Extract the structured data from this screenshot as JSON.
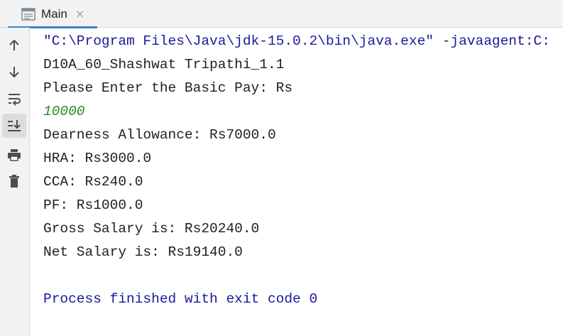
{
  "tab": {
    "label": "Main",
    "close_glyph": "×",
    "icon": "console-window-icon"
  },
  "toolbar": {
    "buttons": [
      {
        "name": "up-arrow-icon",
        "active": false
      },
      {
        "name": "down-arrow-icon",
        "active": false
      },
      {
        "name": "soft-wrap-icon",
        "active": false
      },
      {
        "name": "scroll-to-end-icon",
        "active": true
      },
      {
        "name": "print-icon",
        "active": false
      },
      {
        "name": "trash-icon",
        "active": false
      }
    ]
  },
  "console": {
    "lines": [
      {
        "text": "\"C:\\Program Files\\Java\\jdk-15.0.2\\bin\\java.exe\" -javaagent:C:",
        "kind": "cmd"
      },
      {
        "text": "D10A_60_Shashwat Tripathi_1.1",
        "kind": "out"
      },
      {
        "text": "Please Enter the Basic Pay: Rs",
        "kind": "out"
      },
      {
        "text": "10000",
        "kind": "input"
      },
      {
        "text": "Dearness Allowance: Rs7000.0",
        "kind": "out"
      },
      {
        "text": "HRA: Rs3000.0",
        "kind": "out"
      },
      {
        "text": "CCA: Rs240.0",
        "kind": "out"
      },
      {
        "text": "PF: Rs1000.0",
        "kind": "out"
      },
      {
        "text": "Gross Salary is: Rs20240.0",
        "kind": "out"
      },
      {
        "text": "Net Salary is: Rs19140.0",
        "kind": "out"
      },
      {
        "text": "",
        "kind": "out"
      },
      {
        "text": "Process finished with exit code 0",
        "kind": "exit"
      }
    ]
  },
  "colors": {
    "command": "#1a1a99",
    "user_input": "#228b22",
    "output": "#1f1f1f",
    "tab_underline": "#4083c9"
  }
}
